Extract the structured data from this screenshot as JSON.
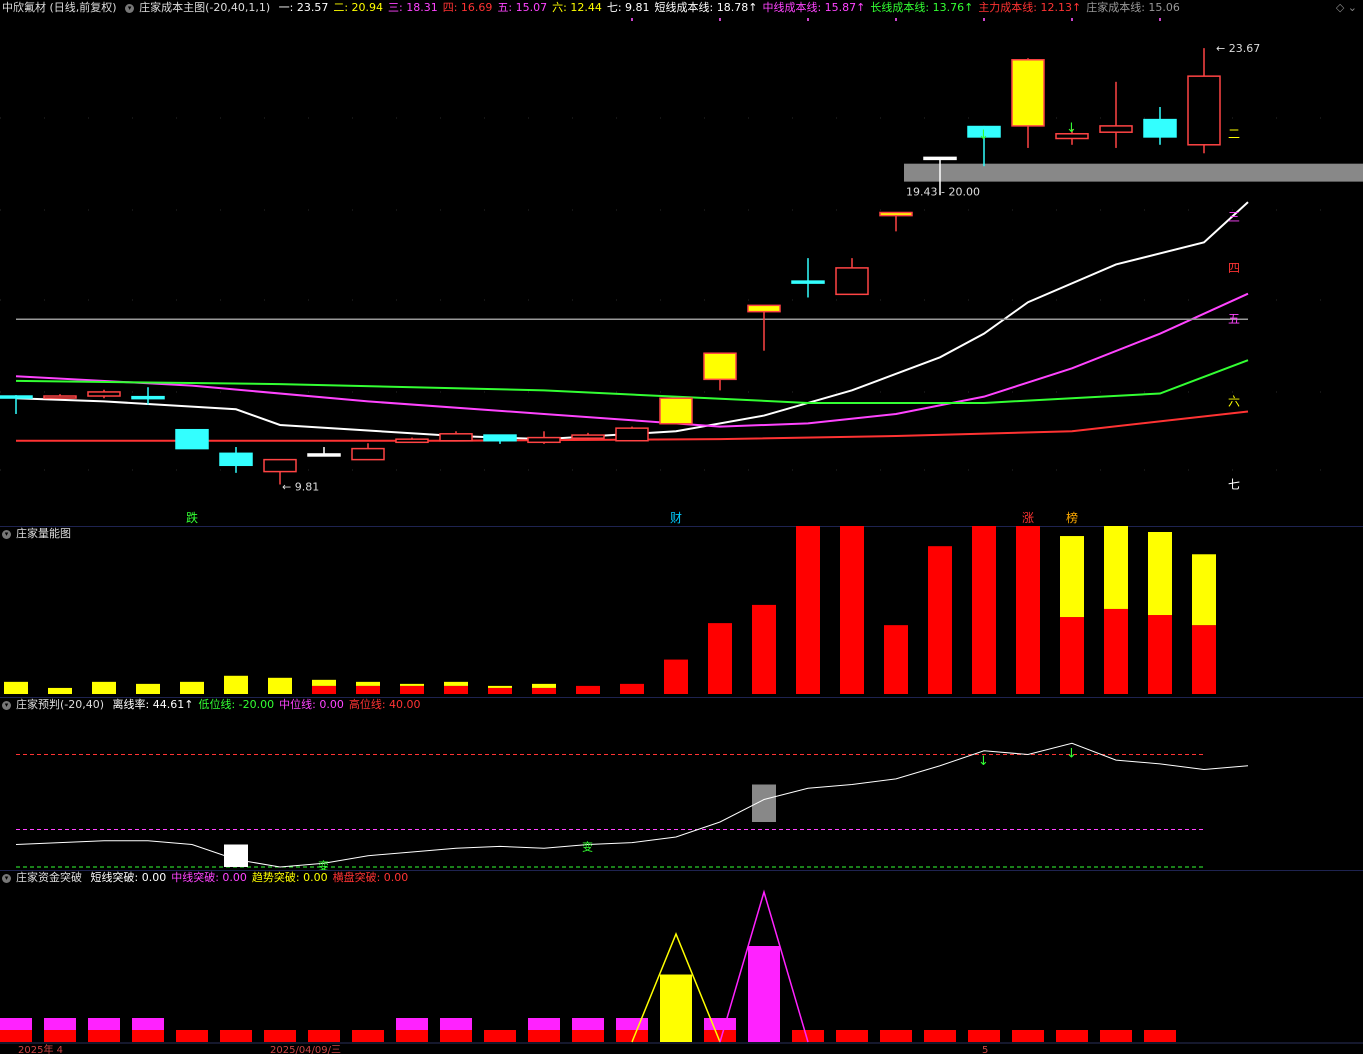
{
  "main": {
    "stock_title": "中欣氟材 (日线,前复权)",
    "indicator_title": "庄家成本主图(-20,40,1,1)",
    "params": [
      {
        "label": "一:",
        "value": "23.57",
        "color": "#ffffff"
      },
      {
        "label": "二:",
        "value": "20.94",
        "color": "#ffff00"
      },
      {
        "label": "三:",
        "value": "18.31",
        "color": "#ff44ff"
      },
      {
        "label": "四:",
        "value": "16.69",
        "color": "#ff3333"
      },
      {
        "label": "五:",
        "value": "15.07",
        "color": "#ff44ff"
      },
      {
        "label": "六:",
        "value": "12.44",
        "color": "#ffff00"
      },
      {
        "label": "七:",
        "value": "9.81",
        "color": "#ffffff"
      },
      {
        "label": "短线成本线:",
        "value": "18.78↑",
        "color": "#ffffff"
      },
      {
        "label": "中线成本线:",
        "value": "15.87↑",
        "color": "#ff44ff"
      },
      {
        "label": "长线成本线:",
        "value": "13.76↑",
        "color": "#33ff33"
      },
      {
        "label": "主力成本线:",
        "value": "12.13↑",
        "color": "#ff3333"
      },
      {
        "label": "庄家成本线:",
        "value": "15.06",
        "color": "#999999"
      }
    ],
    "right_labels": [
      {
        "text": "二",
        "color": "#ffff00"
      },
      {
        "text": "三",
        "color": "#ff44ff"
      },
      {
        "text": "四",
        "color": "#ff3333"
      },
      {
        "text": "五",
        "color": "#ff44ff"
      },
      {
        "text": "六",
        "color": "#ffff00"
      },
      {
        "text": "七",
        "color": "#ffffff"
      }
    ],
    "markers": [
      {
        "text": "跌",
        "color": "#33ff33"
      },
      {
        "text": "财",
        "color": "#00ccff"
      },
      {
        "text": "涨",
        "color": "#ff3333"
      },
      {
        "text": "榜",
        "color": "#ffaa00"
      }
    ],
    "high_label": "23.67",
    "low_label": "9.81",
    "zone_label": "19.43 - 20.00"
  },
  "volume": {
    "title": "庄家量能图"
  },
  "forecast": {
    "title": "庄家预判(-20,40)",
    "params": [
      {
        "label": "离线率:",
        "value": "44.61↑",
        "color": "#ffffff"
      },
      {
        "label": "低位线:",
        "value": "-20.00",
        "color": "#33ff33"
      },
      {
        "label": "中位线:",
        "value": "0.00",
        "color": "#ff44ff"
      },
      {
        "label": "高位线:",
        "value": "40.00",
        "color": "#ff3333"
      }
    ],
    "marks": [
      "变",
      "变"
    ]
  },
  "breakout": {
    "title": "庄家资金突破",
    "params": [
      {
        "label": "短线突破:",
        "value": "0.00",
        "color": "#ffffff"
      },
      {
        "label": "中线突破:",
        "value": "0.00",
        "color": "#ff44ff"
      },
      {
        "label": "趋势突破:",
        "value": "0.00",
        "color": "#ffff00"
      },
      {
        "label": "横盘突破:",
        "value": "0.00",
        "color": "#ff3333"
      }
    ]
  },
  "date_axis": [
    "2025年 4",
    "2025/04/09/三",
    "5"
  ],
  "colors": {
    "up": "#ff4444",
    "down": "#33ffff",
    "flat": "#ffffff",
    "special": "#ffff00",
    "grid": "#1e2350"
  },
  "chart_data": [
    {
      "type": "candlestick",
      "series_name": "中欣氟材",
      "y_range": [
        9.0,
        24.5
      ],
      "candles": [
        {
          "o": 12.62,
          "h": 12.65,
          "l": 12.05,
          "c": 12.62,
          "k": "down"
        },
        {
          "o": 12.58,
          "h": 12.68,
          "l": 12.55,
          "c": 12.62,
          "k": "up"
        },
        {
          "o": 12.62,
          "h": 12.82,
          "l": 12.55,
          "c": 12.75,
          "k": "up"
        },
        {
          "o": 12.6,
          "h": 12.9,
          "l": 12.35,
          "c": 12.55,
          "k": "down"
        },
        {
          "o": 11.55,
          "h": 11.55,
          "l": 11.55,
          "c": 10.95,
          "k": "down"
        },
        {
          "o": 10.8,
          "h": 11.0,
          "l": 10.18,
          "c": 10.42,
          "k": "down"
        },
        {
          "o": 10.22,
          "h": 10.5,
          "l": 9.81,
          "c": 10.6,
          "k": "up"
        },
        {
          "o": 10.78,
          "h": 11.0,
          "l": 10.7,
          "c": 10.78,
          "k": "flat"
        },
        {
          "o": 10.6,
          "h": 11.12,
          "l": 10.6,
          "c": 10.95,
          "k": "up"
        },
        {
          "o": 11.15,
          "h": 11.3,
          "l": 11.15,
          "c": 11.25,
          "k": "up"
        },
        {
          "o": 11.2,
          "h": 11.5,
          "l": 11.2,
          "c": 11.42,
          "k": "up"
        },
        {
          "o": 11.38,
          "h": 11.38,
          "l": 11.1,
          "c": 11.2,
          "k": "down"
        },
        {
          "o": 11.15,
          "h": 11.5,
          "l": 11.1,
          "c": 11.3,
          "k": "up"
        },
        {
          "o": 11.28,
          "h": 11.45,
          "l": 11.25,
          "c": 11.38,
          "k": "up"
        },
        {
          "o": 11.2,
          "h": 11.65,
          "l": 11.2,
          "c": 11.6,
          "k": "up"
        },
        {
          "o": 11.74,
          "h": 12.55,
          "l": 11.74,
          "c": 12.55,
          "k": "special"
        },
        {
          "o": 13.15,
          "h": 13.98,
          "l": 12.8,
          "c": 13.98,
          "k": "special"
        },
        {
          "o": 15.3,
          "h": 15.5,
          "l": 14.06,
          "c": 15.5,
          "k": "special"
        },
        {
          "o": 16.27,
          "h": 17.0,
          "l": 15.75,
          "c": 16.27,
          "k": "down"
        },
        {
          "o": 15.85,
          "h": 17.0,
          "l": 15.85,
          "c": 16.69,
          "k": "up"
        },
        {
          "o": 18.45,
          "h": 18.45,
          "l": 17.85,
          "c": 18.35,
          "k": "special"
        },
        {
          "o": 20.2,
          "h": 20.2,
          "l": 19.0,
          "c": 20.2,
          "k": "flat"
        },
        {
          "o": 21.18,
          "h": 21.2,
          "l": 19.92,
          "c": 20.85,
          "k": "down"
        },
        {
          "o": 21.2,
          "h": 23.35,
          "l": 20.5,
          "c": 23.3,
          "k": "special"
        },
        {
          "o": 20.8,
          "h": 21.1,
          "l": 20.6,
          "c": 20.95,
          "k": "up"
        },
        {
          "o": 21.0,
          "h": 22.6,
          "l": 20.5,
          "c": 21.2,
          "k": "up"
        },
        {
          "o": 21.4,
          "h": 21.8,
          "l": 20.6,
          "c": 20.85,
          "k": "down"
        },
        {
          "o": 20.6,
          "h": 23.67,
          "l": 20.33,
          "c": 22.78,
          "k": "up"
        }
      ],
      "lines": [
        {
          "name": "短线成本线",
          "color": "#ffffff",
          "values": [
            [
              0,
              12.55
            ],
            [
              2,
              12.45
            ],
            [
              5,
              12.2
            ],
            [
              6,
              11.7
            ],
            [
              10,
              11.35
            ],
            [
              12,
              11.25
            ],
            [
              15,
              11.5
            ],
            [
              17,
              12.0
            ],
            [
              19,
              12.8
            ],
            [
              21,
              13.85
            ],
            [
              22,
              14.6
            ],
            [
              23,
              15.6
            ],
            [
              25,
              16.8
            ],
            [
              27,
              17.5
            ],
            [
              28,
              18.78
            ]
          ]
        },
        {
          "name": "中线成本线",
          "color": "#ff44ff",
          "values": [
            [
              0,
              13.25
            ],
            [
              4,
              12.95
            ],
            [
              8,
              12.45
            ],
            [
              12,
              12.05
            ],
            [
              14,
              11.85
            ],
            [
              16,
              11.65
            ],
            [
              18,
              11.75
            ],
            [
              20,
              12.05
            ],
            [
              22,
              12.6
            ],
            [
              24,
              13.5
            ],
            [
              26,
              14.6
            ],
            [
              28,
              15.87
            ]
          ]
        },
        {
          "name": "长线成本线",
          "color": "#33ff33",
          "values": [
            [
              0,
              13.1
            ],
            [
              6,
              13.0
            ],
            [
              12,
              12.8
            ],
            [
              18,
              12.4
            ],
            [
              22,
              12.4
            ],
            [
              26,
              12.7
            ],
            [
              28,
              13.76
            ]
          ]
        },
        {
          "name": "主力成本线",
          "color": "#ff3333",
          "values": [
            [
              0,
              11.2
            ],
            [
              10,
              11.2
            ],
            [
              16,
              11.25
            ],
            [
              20,
              11.35
            ],
            [
              24,
              11.5
            ],
            [
              28,
              12.13
            ]
          ]
        },
        {
          "name": "庄家成本线",
          "color": "#999999",
          "values": [
            [
              0,
              15.06
            ],
            [
              28,
              15.06
            ]
          ]
        }
      ]
    },
    {
      "type": "bar",
      "series_name": "庄家量能图",
      "y_range": [
        0,
        100
      ],
      "bars": [
        {
          "red": 0,
          "yellow": 6
        },
        {
          "red": 0,
          "yellow": 3
        },
        {
          "red": 0,
          "yellow": 6
        },
        {
          "red": 0,
          "yellow": 5
        },
        {
          "red": 0,
          "yellow": 6
        },
        {
          "red": 0,
          "yellow": 9
        },
        {
          "red": 0,
          "yellow": 8
        },
        {
          "red": 4,
          "yellow": 3
        },
        {
          "red": 4,
          "yellow": 2
        },
        {
          "red": 4,
          "yellow": 1
        },
        {
          "red": 4,
          "yellow": 2
        },
        {
          "red": 3,
          "yellow": 1
        },
        {
          "red": 3,
          "yellow": 2
        },
        {
          "red": 4,
          "yellow": 0
        },
        {
          "red": 5,
          "yellow": 0
        },
        {
          "red": 17,
          "yellow": 0
        },
        {
          "red": 35,
          "yellow": 0
        },
        {
          "red": 44,
          "yellow": 0
        },
        {
          "red": 95,
          "yellow": 0
        },
        {
          "red": 87,
          "yellow": 0
        },
        {
          "red": 34,
          "yellow": 0
        },
        {
          "red": 73,
          "yellow": 0
        },
        {
          "red": 88,
          "yellow": 0
        },
        {
          "red": 109,
          "yellow": 0
        },
        {
          "red": 38,
          "yellow": 40
        },
        {
          "red": 42,
          "yellow": 44
        },
        {
          "red": 39,
          "yellow": 41
        },
        {
          "red": 34,
          "yellow": 35
        }
      ]
    },
    {
      "type": "line",
      "series_name": "离线率",
      "y_range": [
        -20,
        60
      ],
      "values": [
        -8,
        -7,
        -6,
        -6,
        -8,
        -16,
        -20,
        -18,
        -14,
        -12,
        -10,
        -9,
        -10,
        -8,
        -7,
        -4,
        4,
        16,
        22,
        24,
        27,
        34,
        42,
        40,
        46,
        37,
        35,
        32,
        34
      ],
      "ref_lines": [
        {
          "name": "高位线",
          "value": 40,
          "color": "#ff3333"
        },
        {
          "name": "中位线",
          "value": 0,
          "color": "#ff44ff"
        },
        {
          "name": "低位线",
          "value": -20,
          "color": "#33ff33"
        }
      ]
    },
    {
      "type": "bar",
      "series_name": "庄家资金突破",
      "y_range": [
        0,
        100
      ],
      "bars": [
        {
          "red": 8,
          "mag": 8,
          "yel": 0
        },
        {
          "red": 8,
          "mag": 8,
          "yel": 0
        },
        {
          "red": 8,
          "mag": 8,
          "yel": 0
        },
        {
          "red": 8,
          "mag": 8,
          "yel": 0
        },
        {
          "red": 8,
          "mag": 0,
          "yel": 0
        },
        {
          "red": 8,
          "mag": 0,
          "yel": 0
        },
        {
          "red": 8,
          "mag": 0,
          "yel": 0
        },
        {
          "red": 8,
          "mag": 0,
          "yel": 0
        },
        {
          "red": 8,
          "mag": 0,
          "yel": 0
        },
        {
          "red": 8,
          "mag": 8,
          "yel": 0
        },
        {
          "red": 8,
          "mag": 8,
          "yel": 0
        },
        {
          "red": 8,
          "mag": 0,
          "yel": 0
        },
        {
          "red": 8,
          "mag": 8,
          "yel": 0
        },
        {
          "red": 8,
          "mag": 8,
          "yel": 0
        },
        {
          "red": 8,
          "mag": 8,
          "yel": 0
        },
        {
          "red": 0,
          "mag": 0,
          "yel": 45
        },
        {
          "red": 8,
          "mag": 8,
          "yel": 0
        },
        {
          "red": 0,
          "mag": 64,
          "yel": 0
        },
        {
          "red": 8,
          "mag": 0,
          "yel": 0
        },
        {
          "red": 8,
          "mag": 0,
          "yel": 0
        },
        {
          "red": 8,
          "mag": 0,
          "yel": 0
        },
        {
          "red": 8,
          "mag": 0,
          "yel": 0
        },
        {
          "red": 8,
          "mag": 0,
          "yel": 0
        },
        {
          "red": 8,
          "mag": 0,
          "yel": 0
        },
        {
          "red": 8,
          "mag": 0,
          "yel": 0
        },
        {
          "red": 8,
          "mag": 0,
          "yel": 0
        },
        {
          "red": 8,
          "mag": 0,
          "yel": 0
        },
        {
          "red": 0,
          "mag": 0,
          "yel": 0
        }
      ],
      "triangles": [
        {
          "index": 15,
          "peak": 72,
          "color": "#ffff00"
        },
        {
          "index": 17,
          "peak": 100,
          "color": "#ff22ff"
        }
      ]
    }
  ]
}
